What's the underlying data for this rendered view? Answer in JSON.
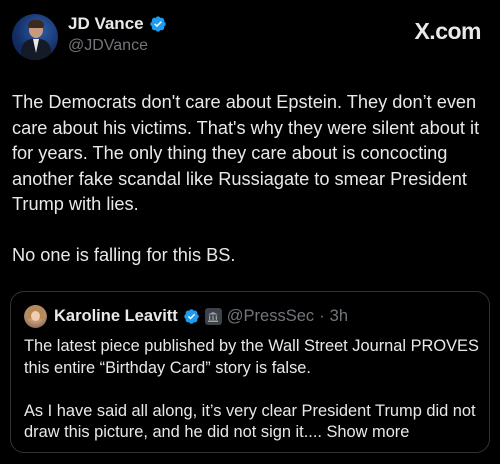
{
  "author": {
    "name": "JD Vance",
    "handle": "@JDVance",
    "verified_color": "#1d9bf0"
  },
  "brand": {
    "label": "X.com"
  },
  "tweet": {
    "text": "The Democrats don't care about Epstein. They don’t even care about his victims. That's why they were silent about it for years. The only thing they care about is concocting another fake scandal like Russiagate to smear President Trump with lies.\n\nNo one is falling for this BS."
  },
  "quote": {
    "name": "Karoline Leavitt",
    "handle": "@PressSec",
    "separator": "·",
    "time": "3h",
    "text": "The latest piece published by the Wall Street Journal PROVES this entire “Birthday Card” story is false.\n\nAs I have said all along, it’s very clear President Trump did not draw this picture, and he did not sign it.... ",
    "show_more": "Show more",
    "verified_color": "#1d9bf0"
  },
  "colors": {
    "background": "#000000",
    "text": "#e7e9ea",
    "secondary_text": "#71767b",
    "border": "#2f3336"
  }
}
